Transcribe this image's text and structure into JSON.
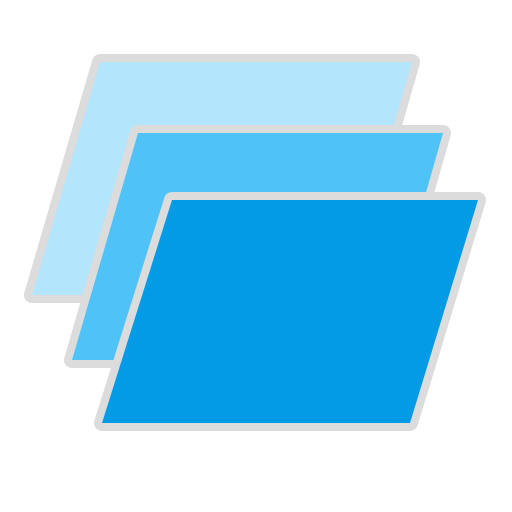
{
  "icon": {
    "name": "stacked-layers-icon",
    "layer_count": 3,
    "colors": {
      "outline": "#dcdcdc",
      "layer_back": "#b3e5fc",
      "layer_middle": "#4fc3f7",
      "layer_front": "#039be5",
      "background": "#ffffff"
    }
  }
}
